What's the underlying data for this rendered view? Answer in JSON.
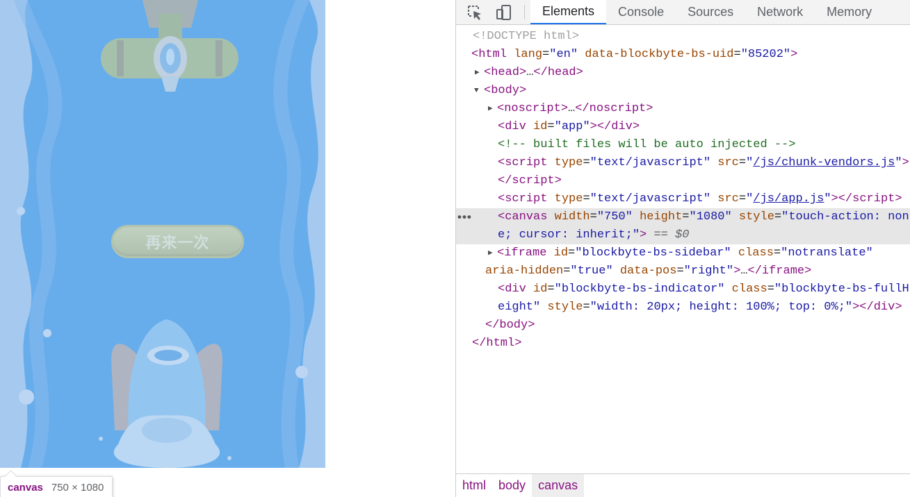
{
  "page": {
    "replay_label": "再来一次",
    "tooltip": {
      "tag": "canvas",
      "size": "750 × 1080"
    },
    "colors": {
      "sky": "#4a9ee8",
      "wave": "#a9c9ee",
      "button": "#c7cb9b"
    }
  },
  "devtools": {
    "icons": [
      "inspect-element-icon",
      "device-toolbar-icon"
    ],
    "tabs": [
      "Elements",
      "Console",
      "Sources",
      "Network",
      "Memory"
    ],
    "active_tab": "Elements",
    "tree": {
      "doctype": "<!DOCTYPE html>",
      "html_open": {
        "tag": "html",
        "a1": "lang",
        "v1": "en",
        "a2": "data-blockbyte-bs-uid",
        "v2": "85202"
      },
      "head": {
        "open": "head",
        "ellipsis": "…",
        "close": "head"
      },
      "body_open": "body",
      "noscript": {
        "open": "noscript",
        "ellipsis": "…",
        "close": "noscript"
      },
      "div_app": {
        "tag": "div",
        "attr": "id",
        "val": "app",
        "close": "div"
      },
      "comment": "<!-- built files will be auto injected -->",
      "script1": {
        "tag": "script",
        "a1": "type",
        "v1": "text/javascript",
        "a2": "src",
        "v2": "/js/chunk-vendors.js",
        "close": "script"
      },
      "script2": {
        "tag": "script",
        "a1": "type",
        "v1": "text/javascript",
        "a2": "src",
        "v2": "/js/app.js",
        "close": "script"
      },
      "canvas": {
        "tag": "canvas",
        "a1": "width",
        "v1": "750",
        "a2": "height",
        "v2": "1080",
        "a3": "style",
        "v3_part1": "touch-action: non",
        "v3_part2": "e; cursor: inherit;",
        "eq": "== $0"
      },
      "iframe": {
        "tag": "iframe",
        "a1": "id",
        "v1": "blockbyte-bs-sidebar",
        "a2": "class",
        "v2": "notranslate",
        "a3": "aria-hidden",
        "v3": "true",
        "a4": "data-pos",
        "v4": "right",
        "ellipsis": "…",
        "close": "iframe"
      },
      "div_indicator": {
        "tag": "div",
        "a1": "id",
        "v1": "blockbyte-bs-indicator",
        "a2": "class",
        "v2_part1": "blockbyte-bs-fullH",
        "v2_part2": "eight",
        "a3": "style",
        "v3": "width: 20px; height: 100%; top: 0%;",
        "close": "div"
      },
      "body_close": "body",
      "html_close": "html"
    },
    "breadcrumbs": [
      "html",
      "body",
      "canvas"
    ],
    "active_breadcrumb": "canvas"
  }
}
